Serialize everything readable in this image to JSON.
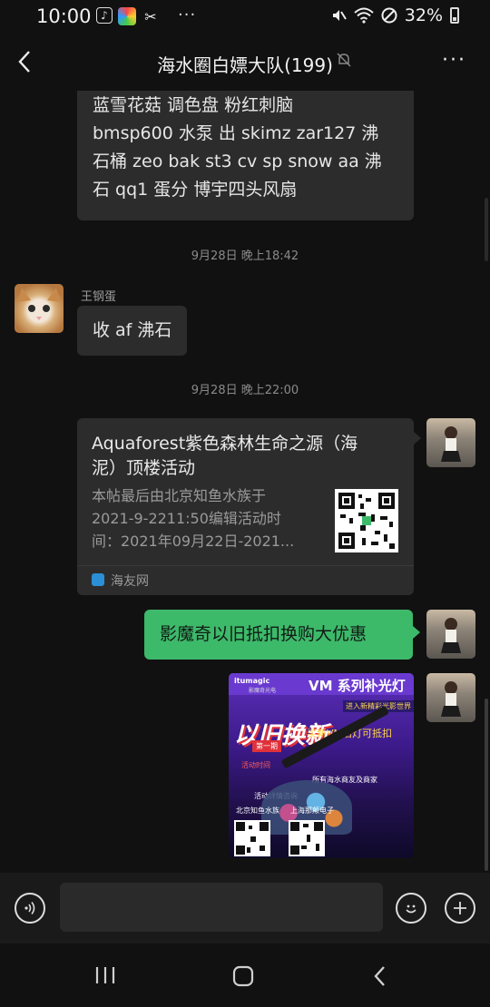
{
  "status_bar": {
    "time": "10:00",
    "battery": "32%",
    "overflow": "···"
  },
  "header": {
    "title": "海水圈白嫖大队(199)",
    "more": "···"
  },
  "messages": {
    "m1_lines": [
      "蓝雪花菇 调色盘 粉红刺脑",
      "bmsp600 水泵 出 skimz zar127 沸",
      "石桶 zeo bak st3 cv sp snow aa 沸",
      "石 qq1 蛋分 博宇四头风扇"
    ],
    "ts1": "9月28日 晚上18:42",
    "sender2": "王钢蛋",
    "m2": "收 af 沸石",
    "ts2": "9月28日 晚上22:00",
    "card": {
      "title_lines": [
        "Aquaforest紫色森林生命之源（海",
        "泥）顶楼活动"
      ],
      "desc_lines": [
        "本帖最后由北京知鱼水族于",
        "2021-9-2211:50编辑活动时",
        "间：2021年09月22日-2021..."
      ],
      "source": "海友网"
    },
    "m4": "影魔奇以旧抵扣换购大优惠",
    "poster": {
      "brand": "itumagic",
      "brand_sub": "影魔奇光电",
      "headline": "VM 系列补光灯",
      "sub": "进入新精彩光影世界",
      "big": "以旧换新",
      "tag": "第一期",
      "offer": "买新VM旧灯可抵扣",
      "date": "活动时间",
      "dealers": "所有海水商友及商家",
      "contact": "活动详情咨询",
      "shop1": "北京知鱼水族",
      "shop2": "上海那颠电子"
    }
  },
  "colors": {
    "bg": "#111111",
    "bubble_gray": "#2c2c2c",
    "bubble_green": "#3db96a"
  }
}
